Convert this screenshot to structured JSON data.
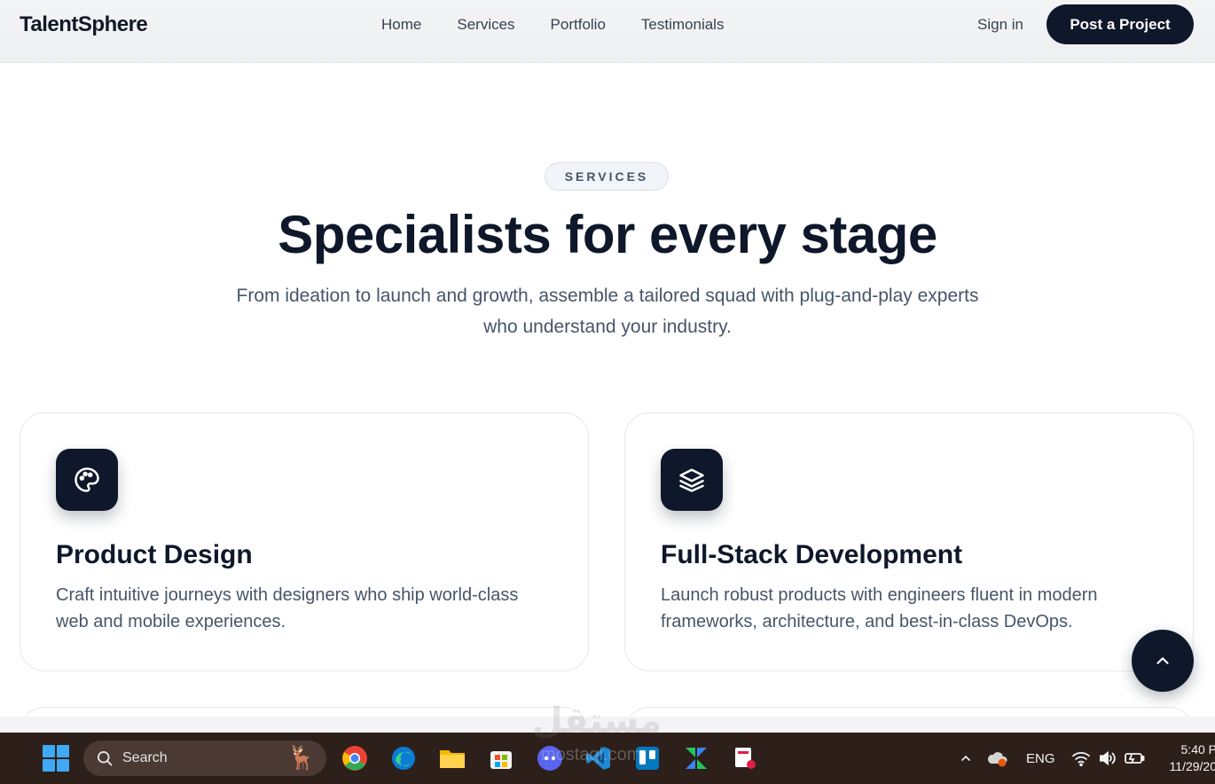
{
  "navbar": {
    "brand": "TalentSphere",
    "links": [
      "Home",
      "Services",
      "Portfolio",
      "Testimonials"
    ],
    "signin": "Sign in",
    "cta": "Post a Project"
  },
  "hero": {
    "badge": "SERVICES",
    "headline": "Specialists for every stage",
    "subhead": "From ideation to launch and growth, assemble a tailored squad with plug-and-play experts who understand your industry."
  },
  "cards": [
    {
      "icon": "palette-icon",
      "title": "Product Design",
      "description": "Craft intuitive journeys with designers who ship world-class web and mobile experiences."
    },
    {
      "icon": "layers-icon",
      "title": "Full-Stack Development",
      "description": "Launch robust products with engineers fluent in modern frameworks, architecture, and best-in-class DevOps."
    }
  ],
  "scroll_top": {
    "icon": "chevron-up-icon"
  },
  "taskbar": {
    "search_placeholder": "Search",
    "language": "ENG",
    "time": "5:40 P",
    "date": "11/29/20"
  },
  "watermark": {
    "arabic": "مستقل",
    "latin": "mostaql.com"
  },
  "colors": {
    "primary": "#0f172a",
    "text_muted": "#475569",
    "border": "#e5e7eb"
  }
}
